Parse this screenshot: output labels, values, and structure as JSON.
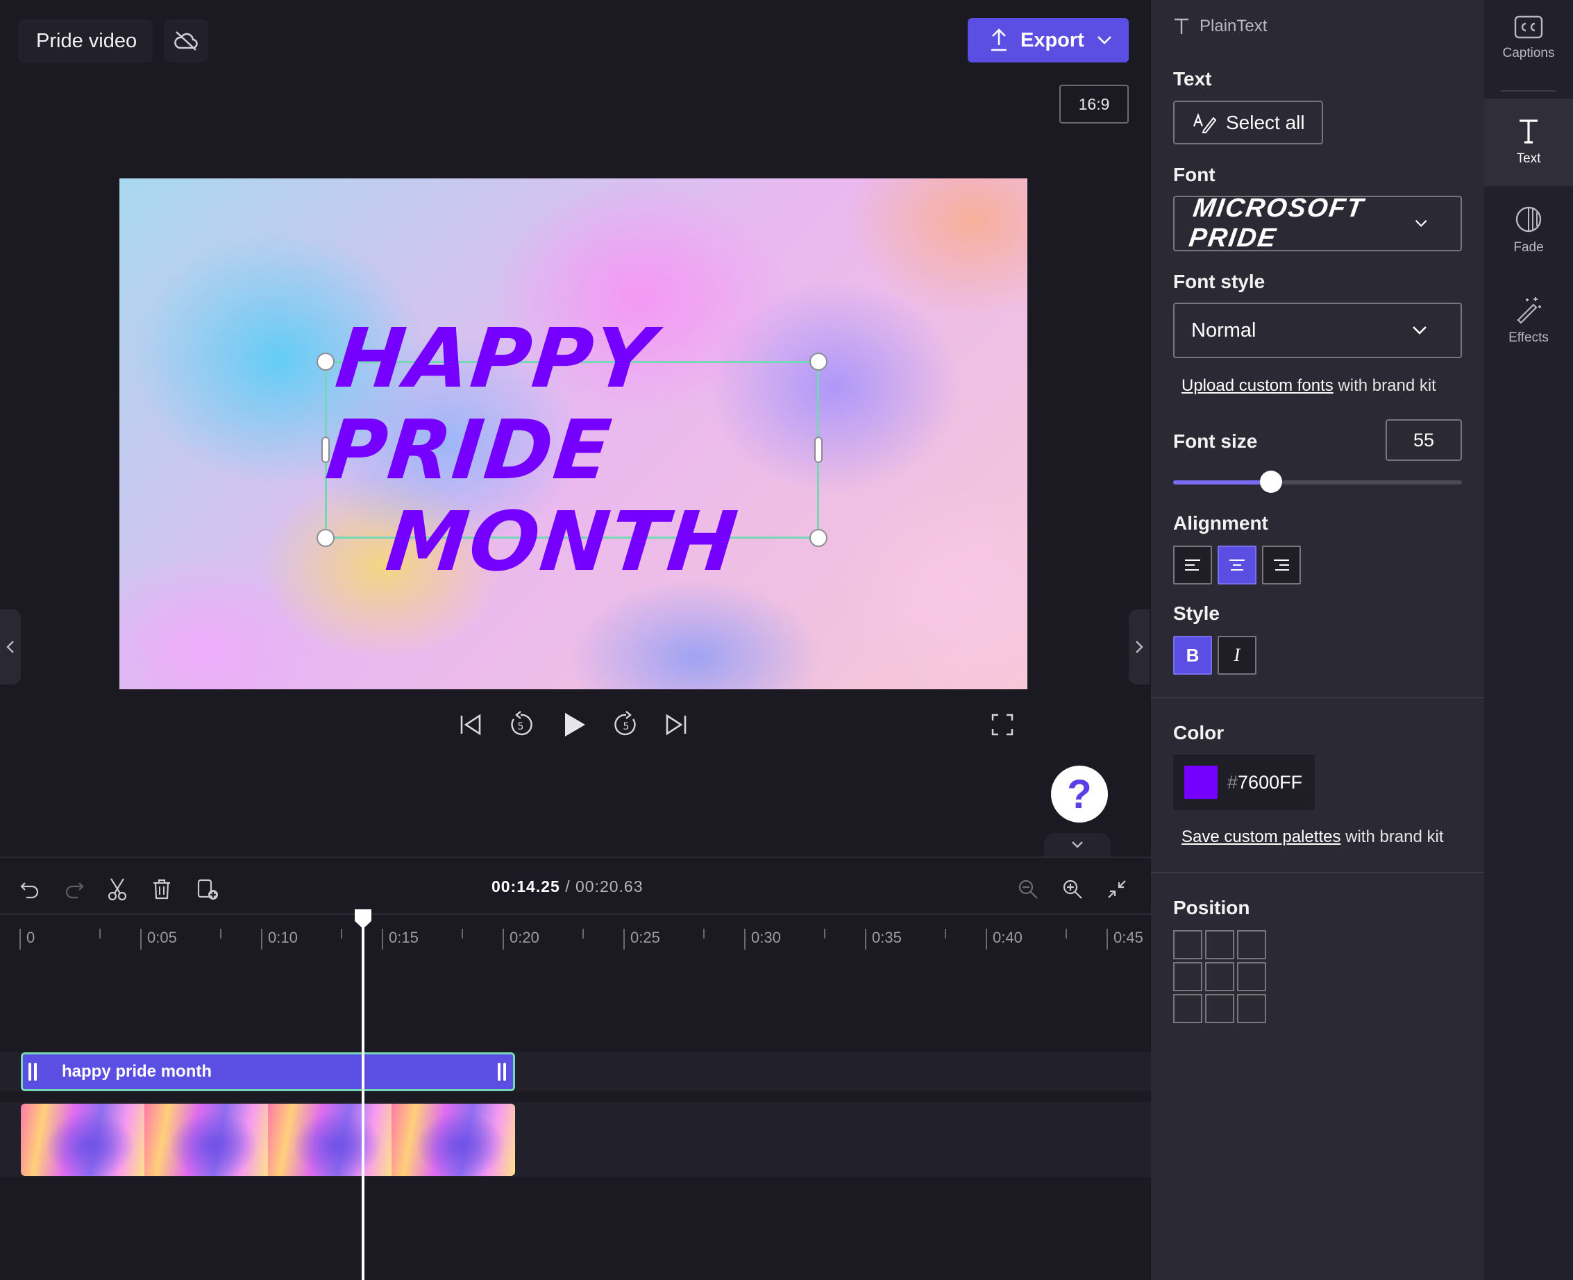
{
  "project": {
    "title": "Pride video",
    "export_label": "Export",
    "aspect_ratio": "16:9"
  },
  "preview": {
    "overlay_lines": [
      "HAPPY PRIDE",
      "MONTH"
    ],
    "text_color": "#7600FF"
  },
  "timeline": {
    "current_time": "00:14.25",
    "separator": "/",
    "total_time": "00:20.63",
    "ruler_labels": [
      "0",
      "0:05",
      "0:10",
      "0:15",
      "0:20",
      "0:25",
      "0:30",
      "0:35",
      "0:40",
      "0:45"
    ],
    "text_clip_label": "happy pride month"
  },
  "properties": {
    "header": "PlainText",
    "text_section": "Text",
    "select_all": "Select all",
    "font_section": "Font",
    "font_value": "MICROSOFT PRIDE",
    "font_style_section": "Font style",
    "font_style_value": "Normal",
    "upload_link": "Upload custom fonts",
    "upload_suffix": " with brand kit",
    "font_size_section": "Font size",
    "font_size_value": "55",
    "font_size_fraction": 0.34,
    "alignment_section": "Alignment",
    "alignment_selected": "center",
    "style_section": "Style",
    "bold_label": "B",
    "italic_label": "I",
    "bold_active": true,
    "color_section": "Color",
    "color_hash": "#",
    "color_value": "7600FF",
    "color_swatch": "#7600FF",
    "palette_link": "Save custom palettes",
    "palette_suffix": " with brand kit",
    "position_section": "Position"
  },
  "rail": {
    "items": [
      {
        "label": "Captions",
        "icon": "captions-icon"
      },
      {
        "label": "Text",
        "icon": "text-icon",
        "active": true
      },
      {
        "label": "Fade",
        "icon": "fade-icon"
      },
      {
        "label": "Effects",
        "icon": "effects-wand-icon"
      }
    ]
  },
  "colors": {
    "accent": "#5B4FE3",
    "selection": "#74D8B6",
    "background": "#1B1A23",
    "panel": "#2A2934"
  }
}
